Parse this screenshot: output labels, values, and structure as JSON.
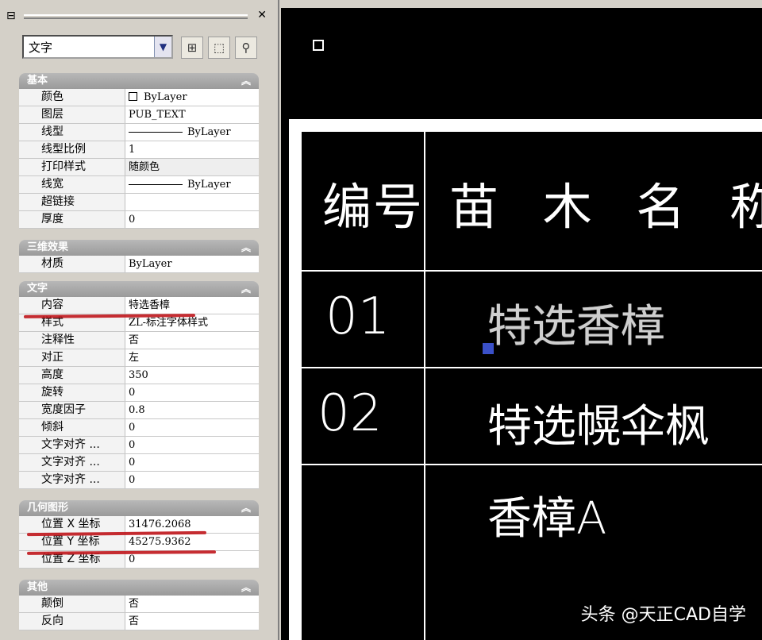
{
  "palette": {
    "object_type": "文字",
    "sections": {
      "basic": {
        "title": "基本",
        "rows": [
          {
            "key": "颜色",
            "value": "ByLayer"
          },
          {
            "key": "图层",
            "value": "PUB_TEXT"
          },
          {
            "key": "线型",
            "value": "ByLayer"
          },
          {
            "key": "线型比例",
            "value": "1"
          },
          {
            "key": "打印样式",
            "value": "随颜色"
          },
          {
            "key": "线宽",
            "value": "ByLayer"
          },
          {
            "key": "超链接",
            "value": ""
          },
          {
            "key": "厚度",
            "value": "0"
          }
        ]
      },
      "three_d": {
        "title": "三维效果",
        "rows": [
          {
            "key": "材质",
            "value": "ByLayer"
          }
        ]
      },
      "text": {
        "title": "文字",
        "rows": [
          {
            "key": "内容",
            "value": "特选香樟"
          },
          {
            "key": "样式",
            "value": "ZL-标注字体样式"
          },
          {
            "key": "注释性",
            "value": "否"
          },
          {
            "key": "对正",
            "value": "左"
          },
          {
            "key": "高度",
            "value": "350"
          },
          {
            "key": "旋转",
            "value": "0"
          },
          {
            "key": "宽度因子",
            "value": "0.8"
          },
          {
            "key": "倾斜",
            "value": "0"
          },
          {
            "key": "文字对齐 ...",
            "value": "0"
          },
          {
            "key": "文字对齐 ...",
            "value": "0"
          },
          {
            "key": "文字对齐 ...",
            "value": "0"
          }
        ]
      },
      "geometry": {
        "title": "几何图形",
        "rows": [
          {
            "key": "位置 X 坐标",
            "value": "31476.2068"
          },
          {
            "key": "位置 Y 坐标",
            "value": "45275.9362"
          },
          {
            "key": "位置 Z 坐标",
            "value": "0"
          }
        ]
      },
      "misc": {
        "title": "其他",
        "rows": [
          {
            "key": "颠倒",
            "value": "否"
          },
          {
            "key": "反向",
            "value": "否"
          }
        ]
      }
    }
  },
  "drawing": {
    "header": {
      "col1": "编号",
      "col2": "苗 木 名 称"
    },
    "rows": [
      {
        "num": "01",
        "name": "特选香樟"
      },
      {
        "num": "02",
        "name": "特选幌伞枫"
      },
      {
        "num": "",
        "name": "香樟A"
      }
    ]
  },
  "watermark": "头条 @天正CAD自学",
  "colors": {
    "annotation_red": "#c0161c",
    "grip_blue": "#3a50c8",
    "canvas": "#000000"
  }
}
